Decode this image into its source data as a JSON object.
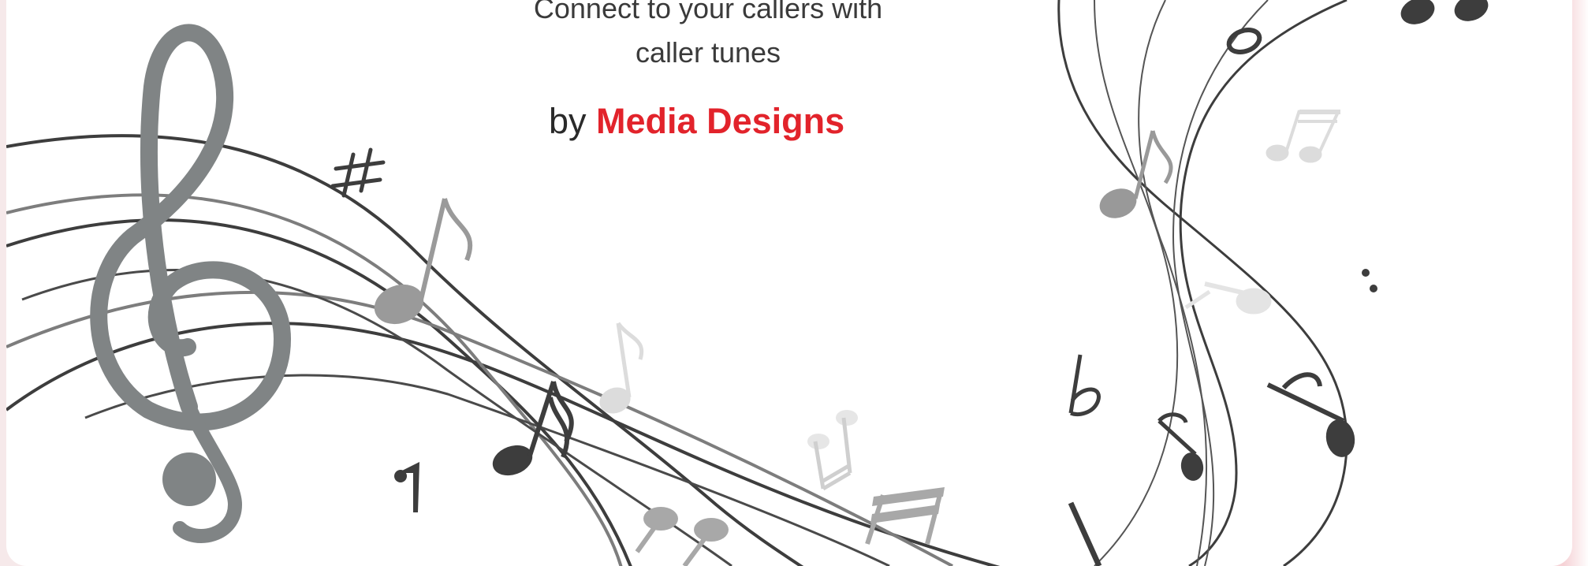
{
  "hero": {
    "tagline_line1": "Connect to your callers with",
    "tagline_line2": "caller tunes",
    "by_label": "by",
    "brand_name": "Media Designs"
  },
  "colors": {
    "brand": "#e2232b",
    "text": "#2a2a2a",
    "staff_dark": "#3d3d3d",
    "clef_gray": "#808485",
    "note_light": "#dcdcdc"
  },
  "icons": [
    "treble-clef-icon",
    "sharp-icon",
    "flat-icon",
    "eighth-note-icon",
    "beamed-notes-icon",
    "whole-note-icon",
    "rest-icon"
  ]
}
